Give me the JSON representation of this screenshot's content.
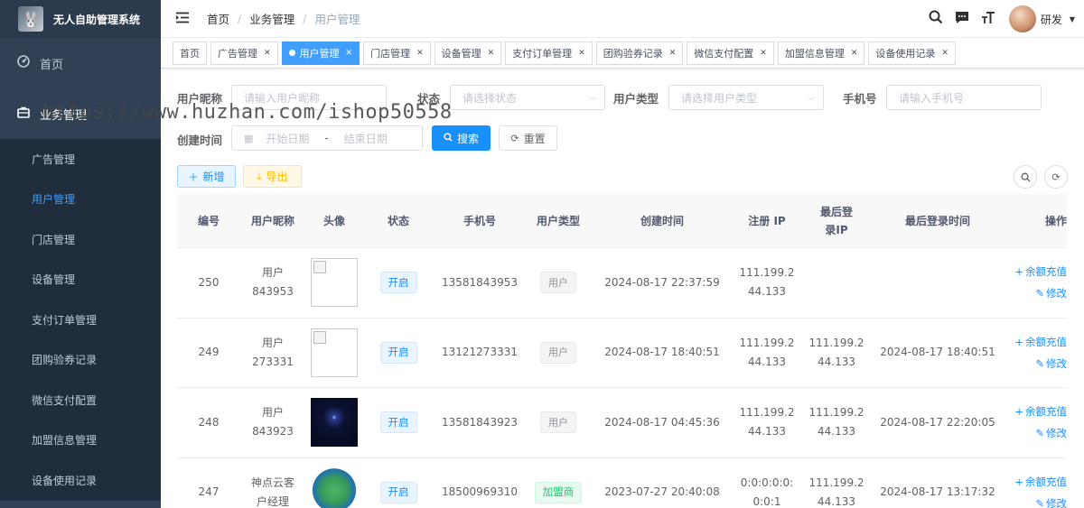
{
  "app": {
    "title": "无人自助管理系统"
  },
  "sidebar": {
    "home": "首页",
    "group": "业务管理",
    "items": [
      "广告管理",
      "用户管理",
      "门店管理",
      "设备管理",
      "支付订单管理",
      "团购验券记录",
      "微信支付配置",
      "加盟信息管理",
      "设备使用记录"
    ],
    "active_index": 1
  },
  "breadcrumb": [
    "首页",
    "业务管理",
    "用户管理"
  ],
  "navbar": {
    "user_name": "研发"
  },
  "tags": [
    "首页",
    "广告管理",
    "用户管理",
    "门店管理",
    "设备管理",
    "支付订单管理",
    "团购验券记录",
    "微信支付配置",
    "加盟信息管理",
    "设备使用记录"
  ],
  "active_tag": "用户管理",
  "search": {
    "nickname_label": "用户昵称",
    "nickname_placeholder": "请输入用户昵称",
    "status_label": "状态",
    "status_placeholder": "请选择状态",
    "usertype_label": "用户类型",
    "usertype_placeholder": "请选择用户类型",
    "phone_label": "手机号",
    "phone_placeholder": "请输入手机号",
    "created_label": "创建时间",
    "start_placeholder": "开始日期",
    "date_sep": "-",
    "end_placeholder": "结束日期",
    "search_button": "搜索",
    "reset_button": "重置"
  },
  "toolbar": {
    "add_button": "新增",
    "export_button": "导出"
  },
  "table": {
    "headers": [
      "编号",
      "用户昵称",
      "头像",
      "状态",
      "手机号",
      "用户类型",
      "创建时间",
      "注册 IP",
      "最后登录IP",
      "最后登录时间",
      "操作"
    ],
    "rows": [
      {
        "id": "250",
        "nickname": "用户843953",
        "avatar": "broken",
        "status": "开启",
        "phone": "13581843953",
        "user_type": "用户",
        "user_type_kind": "user",
        "created": "2024-08-17 22:37:59",
        "reg_ip": "111.199.244.133",
        "last_ip": "",
        "last_time": ""
      },
      {
        "id": "249",
        "nickname": "用户273331",
        "avatar": "broken",
        "status": "开启",
        "phone": "13121273331",
        "user_type": "用户",
        "user_type_kind": "user",
        "created": "2024-08-17 18:40:51",
        "reg_ip": "111.199.244.133",
        "last_ip": "111.199.244.133",
        "last_time": "2024-08-17 18:40:51"
      },
      {
        "id": "248",
        "nickname": "用户843923",
        "avatar": "space",
        "status": "开启",
        "phone": "13581843923",
        "user_type": "用户",
        "user_type_kind": "user",
        "created": "2024-08-17 04:45:36",
        "reg_ip": "111.199.244.133",
        "last_ip": "111.199.244.133",
        "last_time": "2024-08-17 22:20:05"
      },
      {
        "id": "247",
        "nickname": "神点云客户经理",
        "avatar": "logo",
        "status": "开启",
        "phone": "18500969310",
        "user_type": "加盟商",
        "user_type_kind": "franchise",
        "created": "2023-07-27 20:40:08",
        "reg_ip": "0:0:0:0:0:0:0:1",
        "last_ip": "111.199.244.133",
        "last_time": "2024-08-17 13:17:32"
      }
    ],
    "ops": {
      "recharge": "余额充值",
      "edit": "修改"
    }
  },
  "watermark": "https://www.huzhan.com/ishop50558"
}
